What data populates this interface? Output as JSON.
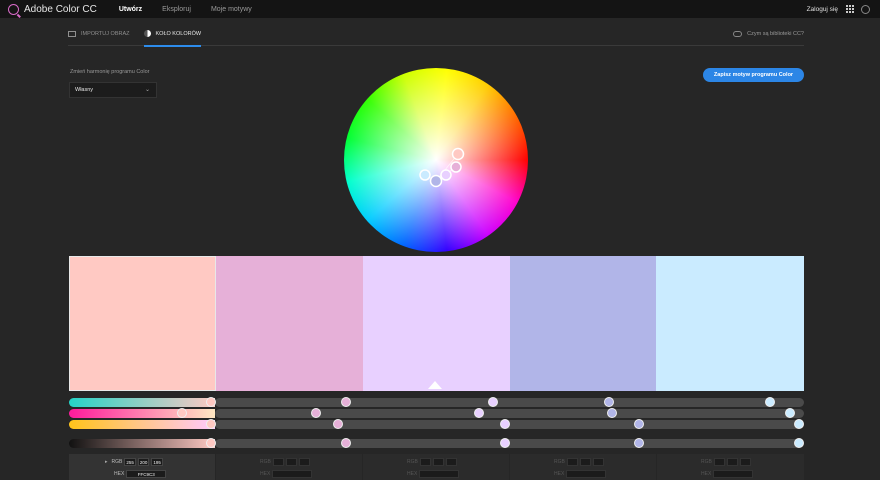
{
  "topbar": {
    "app_title": "Adobe Color CC",
    "nav": [
      "Utwórz",
      "Eksploruj",
      "Moje motywy"
    ],
    "active_nav": "Utwórz",
    "login": "Zaloguj się"
  },
  "subnav": {
    "tabs": [
      "IMPORTUJ OBRAZ",
      "KOŁO KOLORÓW"
    ],
    "active_tab": "KOŁO KOLORÓW",
    "libraries_link": "Czym są biblioteki CC?"
  },
  "harmony": {
    "label": "Zmień harmonię programu Color",
    "selected": "Własny"
  },
  "save_button": "Zapisz motyw programu Color",
  "colors": [
    {
      "hex": "#FFC9C3",
      "rgb": [
        255,
        200,
        195
      ],
      "hex_label": "FFC9C3",
      "base": true
    },
    {
      "hex": "#E6B0D8",
      "rgb": [
        230,
        176,
        216
      ],
      "base": false
    },
    {
      "hex": "#E8D0FF",
      "rgb": [
        232,
        208,
        255
      ],
      "base": false
    },
    {
      "hex": "#B1B5E8",
      "rgb": [
        177,
        181,
        232
      ],
      "base": false
    },
    {
      "hex": "#CAEBFF",
      "rgb": [
        202,
        235,
        255
      ],
      "base": false
    }
  ],
  "value_labels": {
    "rgb": "RGB",
    "hex": "HEX"
  },
  "rgb_boxes": [
    "255",
    "200",
    "195"
  ],
  "hex_box": "FFC9C3"
}
